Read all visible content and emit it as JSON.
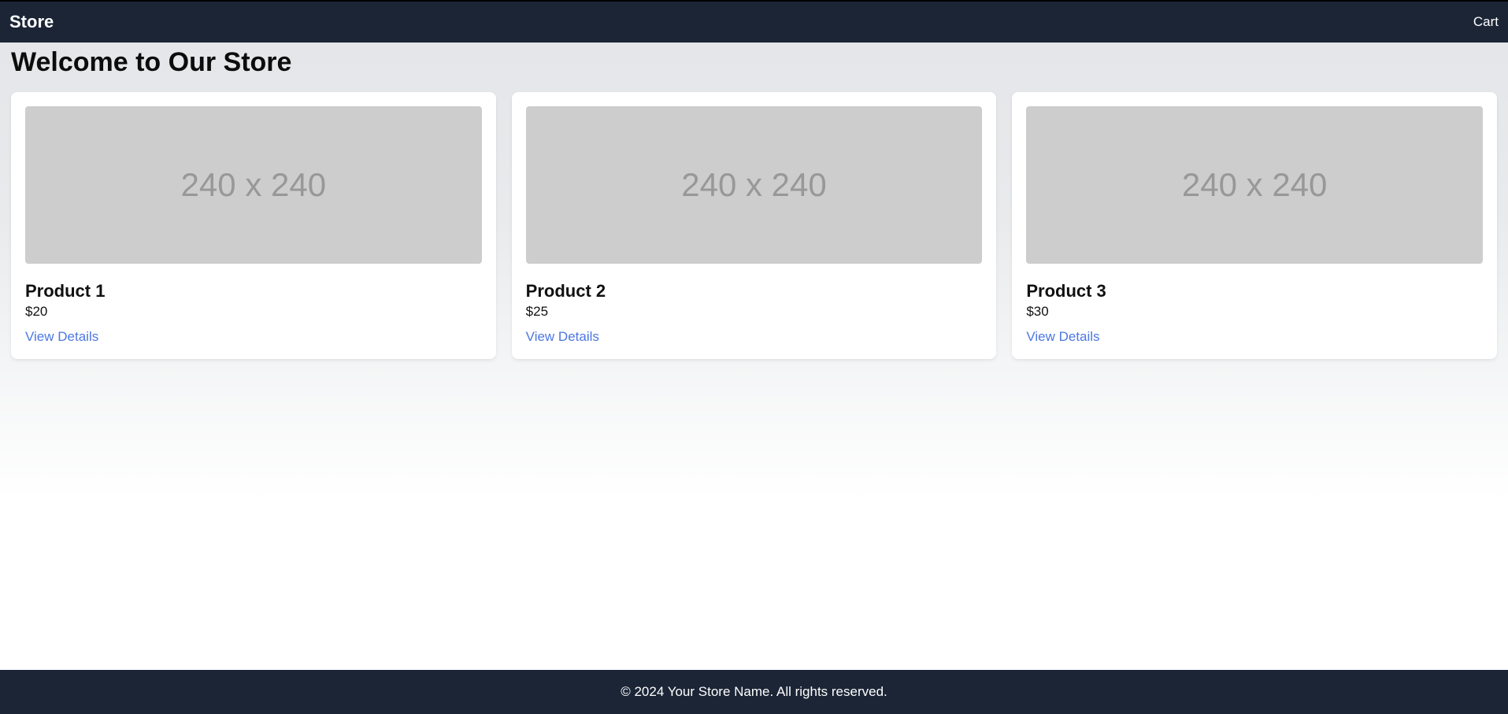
{
  "header": {
    "brand": "Store",
    "cart_label": "Cart"
  },
  "main": {
    "title": "Welcome to Our Store",
    "placeholder_text": "240 x 240",
    "products": [
      {
        "name": "Product 1",
        "price": "$20",
        "link_label": "View Details"
      },
      {
        "name": "Product 2",
        "price": "$25",
        "link_label": "View Details"
      },
      {
        "name": "Product 3",
        "price": "$30",
        "link_label": "View Details"
      }
    ]
  },
  "footer": {
    "text": "© 2024 Your Store Name. All rights reserved."
  }
}
